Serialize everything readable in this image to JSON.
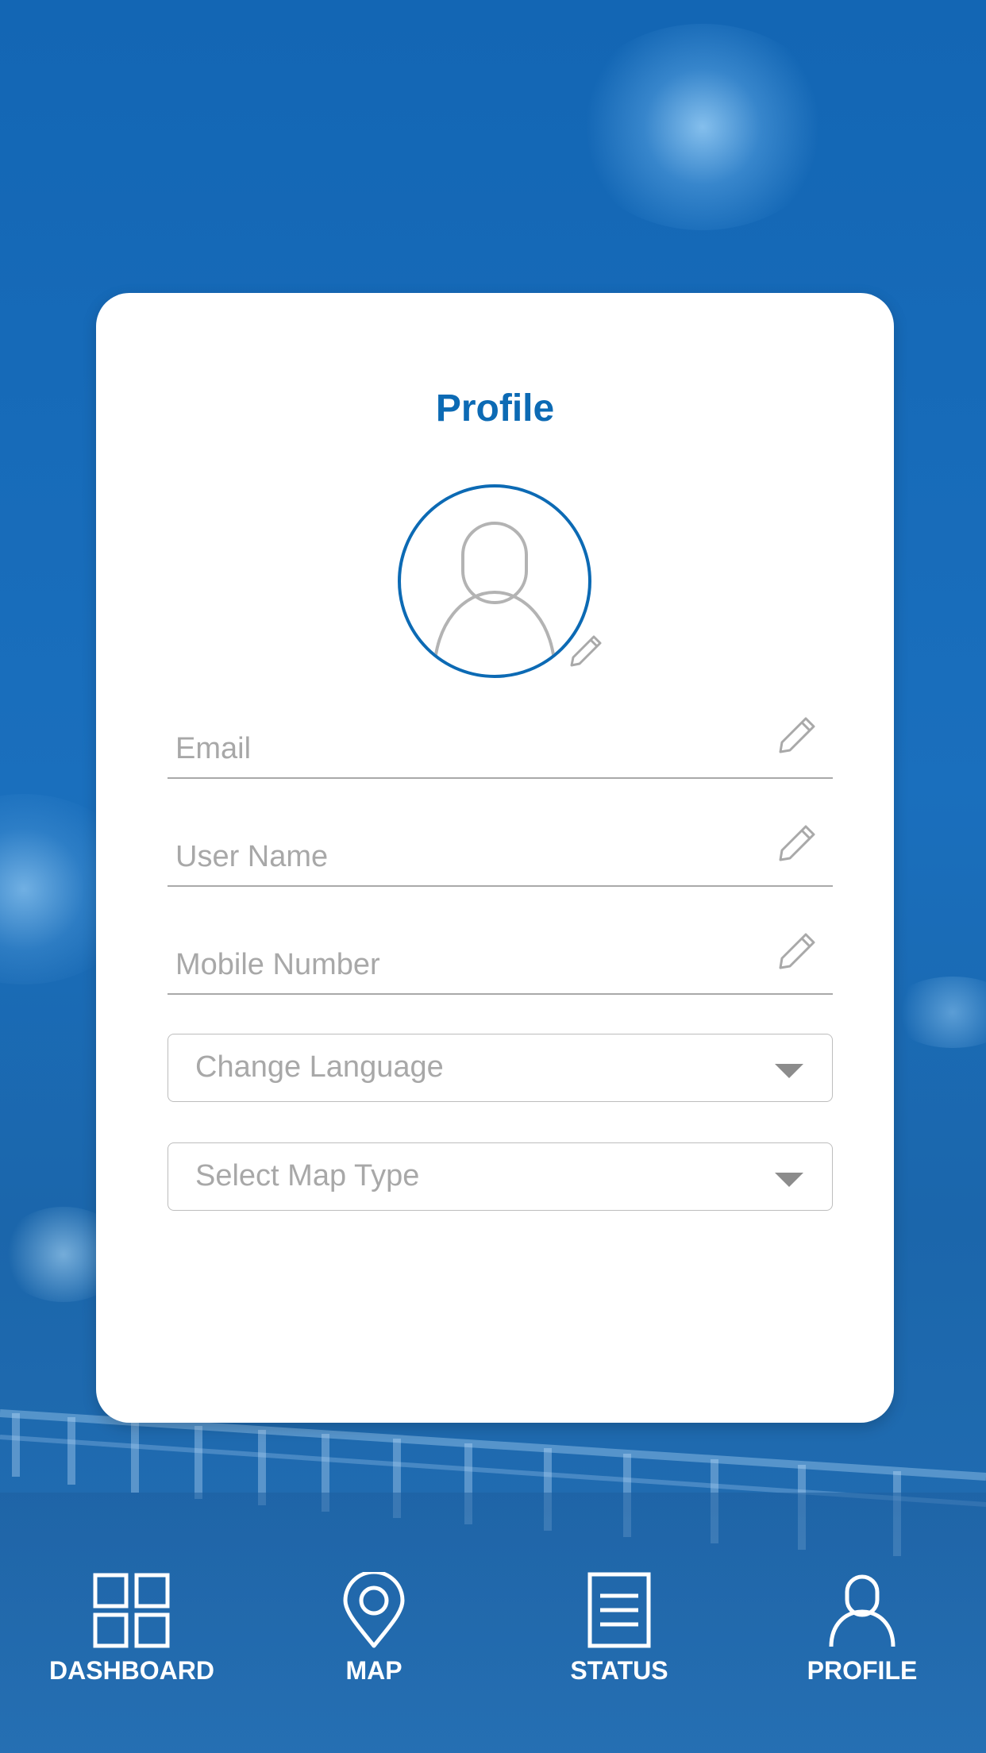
{
  "profile": {
    "title": "Profile",
    "avatar_icon": "user-silhouette-icon",
    "avatar_edit_icon": "pencil-icon",
    "fields": [
      {
        "placeholder": "Email",
        "edit_icon": "pencil-icon"
      },
      {
        "placeholder": "User Name",
        "edit_icon": "pencil-icon"
      },
      {
        "placeholder": "Mobile Number",
        "edit_icon": "pencil-icon"
      }
    ],
    "selects": [
      {
        "placeholder": "Change Language",
        "icon": "caret-down-icon"
      },
      {
        "placeholder": "Select Map Type",
        "icon": "caret-down-icon"
      }
    ]
  },
  "tabs": [
    {
      "label": "DASHBOARD",
      "icon": "grid-icon"
    },
    {
      "label": "MAP",
      "icon": "map-pin-icon"
    },
    {
      "label": "STATUS",
      "icon": "document-icon"
    },
    {
      "label": "PROFILE",
      "icon": "user-icon",
      "active": true
    }
  ],
  "colors": {
    "accent": "#0c6ab4",
    "background": "#1a6fbd",
    "placeholder_text": "#a8a8a8",
    "card": "#ffffff"
  }
}
